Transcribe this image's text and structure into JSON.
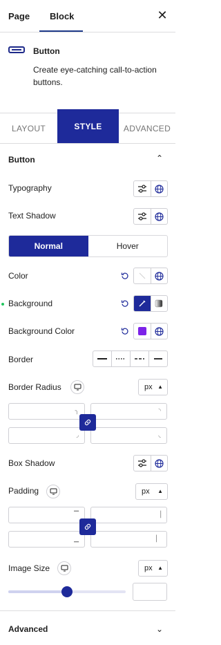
{
  "header": {
    "tab_page": "Page",
    "tab_block": "Block",
    "close_glyph": "✕"
  },
  "block": {
    "icon": "button-icon",
    "title": "Button",
    "description": "Create eye-catching call-to-action buttons."
  },
  "tabs": [
    {
      "label": "LAYOUT"
    },
    {
      "label": "STYLE"
    },
    {
      "label": "ADVANCED"
    }
  ],
  "active_tab": "STYLE",
  "section": {
    "title": "Button",
    "chevron": "⌃"
  },
  "rows": {
    "typography": "Typography",
    "text_shadow": "Text Shadow",
    "color": "Color",
    "background": "Background",
    "background_color": "Background Color",
    "border": "Border",
    "border_radius": "Border Radius",
    "box_shadow": "Box Shadow",
    "padding": "Padding",
    "image_size": "Image Size"
  },
  "state_toggle": {
    "normal": "Normal",
    "hover": "Hover",
    "selected": "Normal"
  },
  "units": {
    "border_radius": "px",
    "padding": "px",
    "image_size": "px"
  },
  "colors": {
    "accent": "#1e2a9a",
    "background_color_swatch": "#7c22e8",
    "modified_dot": "#22c55e"
  },
  "image_size_slider": {
    "level": 0.5
  },
  "advanced": {
    "title": "Advanced",
    "chevron": "⌄"
  }
}
